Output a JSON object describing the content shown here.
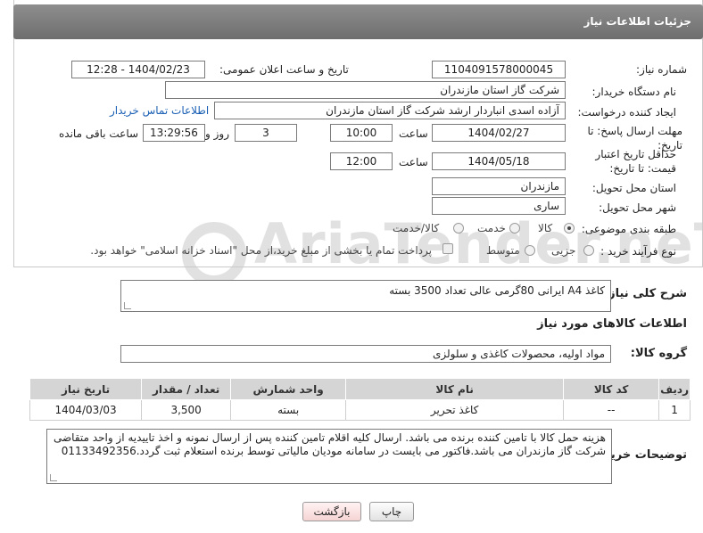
{
  "header": {
    "title": "جزئیات اطلاعات نیاز"
  },
  "form": {
    "need_number_label": "شماره نیاز:",
    "need_number": "1104091578000045",
    "announce_label": "تاریخ و ساعت اعلان عمومی:",
    "announce_value": "1404/02/23 - 12:28",
    "buyer_org_label": "نام دستگاه خریدار:",
    "buyer_org": "شرکت گاز استان مازندران",
    "creator_label": "ایجاد کننده درخواست:",
    "creator": "آزاده اسدی انباردار ارشد شرکت گاز استان مازندران",
    "contact_link": "اطلاعات تماس خریدار",
    "reply_deadline_label": "مهلت ارسال پاسخ: تا تاریخ:",
    "reply_date": "1404/02/27",
    "time_label": "ساعت",
    "reply_time": "10:00",
    "days_value": "3",
    "days_label": "روز و",
    "remaining_time": "13:29:56",
    "remaining_label": "ساعت باقی مانده",
    "price_deadline_label": "حداقل تاریخ اعتبار قیمت: تا تاریخ:",
    "price_date": "1404/05/18",
    "price_time": "12:00",
    "province_label": "استان محل تحویل:",
    "province": "مازندران",
    "city_label": "شهر محل تحویل:",
    "city": "ساری",
    "category_label": "طبقه بندی موضوعی:",
    "category_options": [
      "کالا",
      "خدمت",
      "کالا/خدمت"
    ],
    "category_selected": 0,
    "process_label": "نوع فرآیند خرید :",
    "process_options": [
      "جزیی",
      "متوسط"
    ],
    "process_note": "پرداخت تمام یا بخشی از مبلغ خرید،از محل \"اسناد خزانه اسلامی\" خواهد بود."
  },
  "description": {
    "label": "شرح کلی نیاز:",
    "text": "کاغذ A4  ایرانی 80گرمی عالی تعداد 3500 بسته"
  },
  "goods": {
    "section_title": "اطلاعات کالاهای مورد نیاز",
    "group_label": "گروه کالا:",
    "group_value": "مواد اولیه، محصولات کاغذی و سلولزی",
    "columns": [
      "ردیف",
      "کد کالا",
      "نام کالا",
      "واحد شمارش",
      "تعداد / مقدار",
      "تاریخ نیاز"
    ],
    "rows": [
      {
        "row": "1",
        "code": "--",
        "name": "کاغذ تحریر",
        "unit": "بسته",
        "qty": "3,500",
        "date": "1404/03/03"
      }
    ]
  },
  "buyer_notes": {
    "label": "توضیحات خریدار:",
    "text": "هزینه حمل کالا با تامین کننده برنده می باشد. ارسال کلیه اقلام تامین کننده پس از ارسال نمونه و اخذ تاییدیه از واحد متقاضی شرکت گاز مازندران می باشد.فاکتور می بایست در سامانه مودیان مالیاتی توسط برنده استعلام ثبت گردد.01133492356"
  },
  "buttons": {
    "print": "چاپ",
    "back": "بازگشت"
  },
  "watermark": "AriaTender.neT",
  "colors": {
    "header_bg": "#7d7d7d",
    "link": "#1a5fb4",
    "back_btn": "#f6d4d4"
  }
}
